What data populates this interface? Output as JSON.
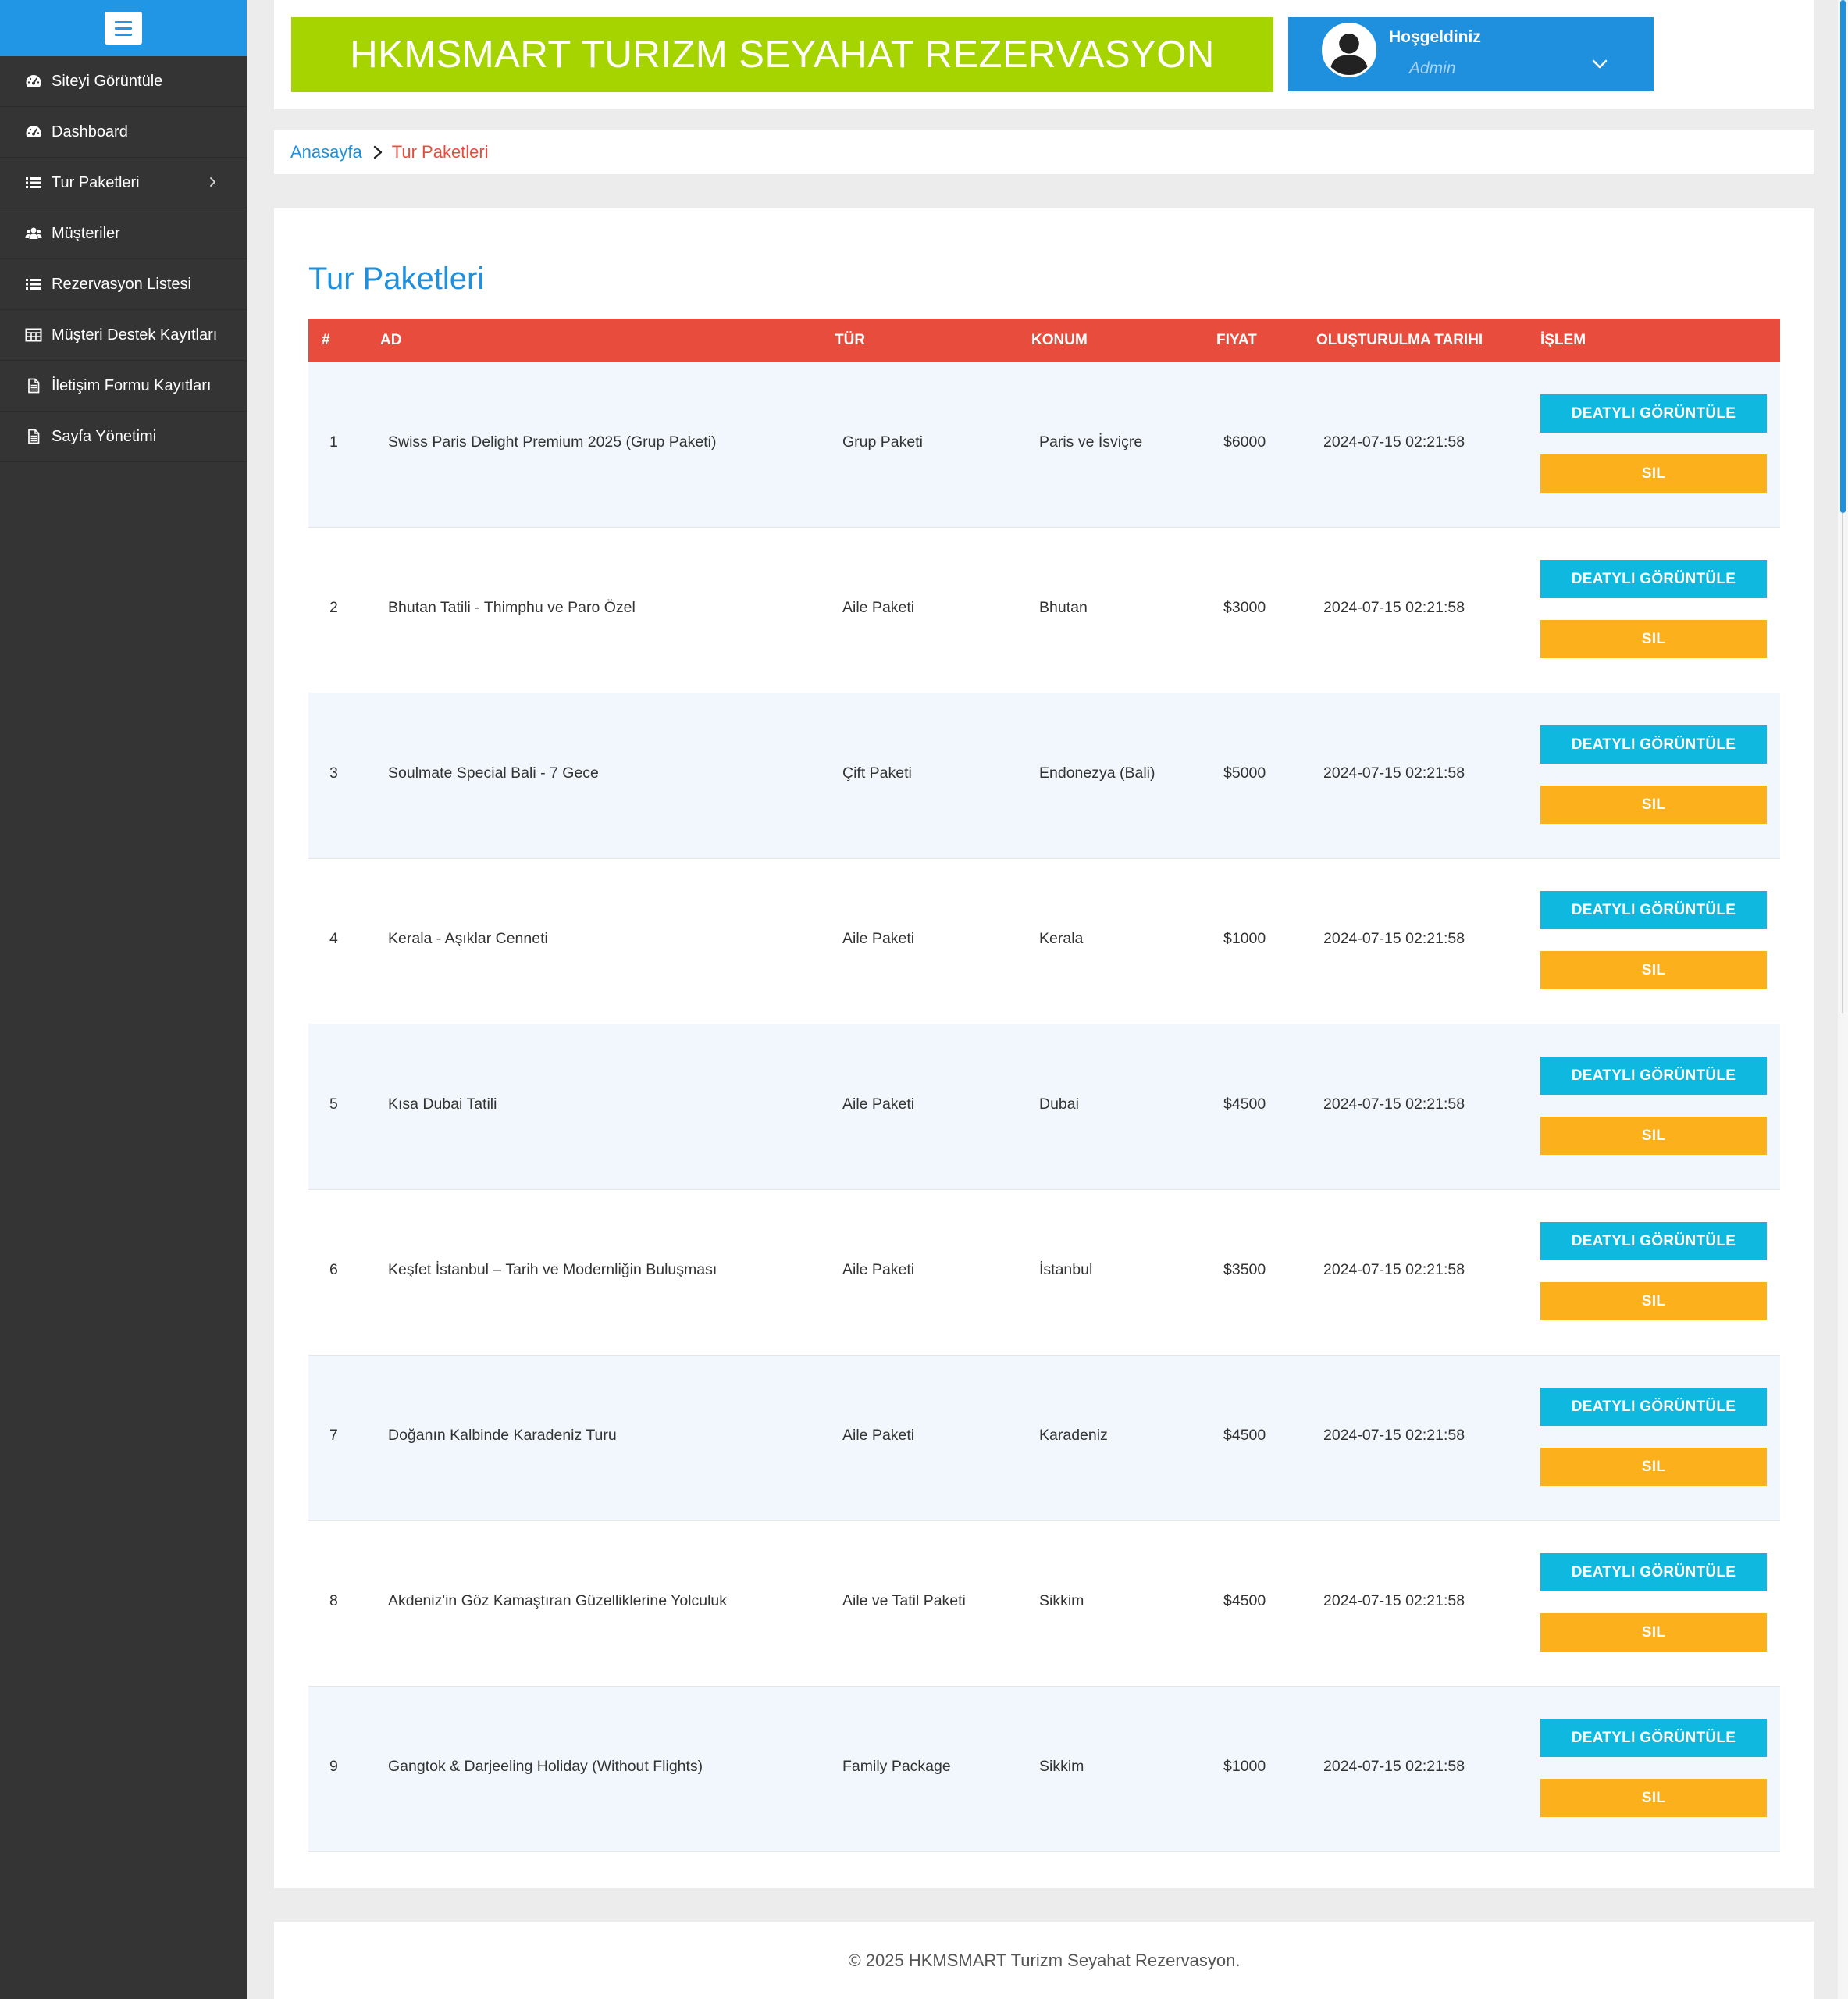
{
  "sidebar": {
    "items": [
      {
        "label": "Siteyi Görüntüle",
        "icon": "dashboard-gauge-icon"
      },
      {
        "label": "Dashboard",
        "icon": "dashboard-gauge-icon"
      },
      {
        "label": "Tur Paketleri",
        "icon": "list-icon",
        "has_submenu": true
      },
      {
        "label": "Müşteriler",
        "icon": "users-icon"
      },
      {
        "label": "Rezervasyon Listesi",
        "icon": "list-icon"
      },
      {
        "label": "Müşteri Destek Kayıtları",
        "icon": "table-icon"
      },
      {
        "label": "İletişim Formu Kayıtları",
        "icon": "file-text-icon"
      },
      {
        "label": "Sayfa Yönetimi",
        "icon": "file-text-icon"
      }
    ]
  },
  "header": {
    "brand": "HKMSMART TURIZM SEYAHAT REZERVASYON",
    "welcome": "Hoşgeldiniz",
    "role": "Admin"
  },
  "breadcrumb": {
    "home": "Anasayfa",
    "current": "Tur Paketleri"
  },
  "main": {
    "title": "Tur Paketleri",
    "columns": [
      "#",
      "AD",
      "TÜR",
      "KONUM",
      "FIYAT",
      "OLUŞTURULMA TARIHI",
      "İŞLEM"
    ],
    "detail_label": "DEATYLI GÖRÜNTÜLE",
    "delete_label": "SIL",
    "rows": [
      {
        "num": "1",
        "ad": "Swiss Paris Delight Premium 2025 (Grup Paketi)",
        "tur": "Grup Paketi",
        "konum": "Paris ve İsviçre",
        "fiyat": "$6000",
        "tarih": "2024-07-15 02:21:58"
      },
      {
        "num": "2",
        "ad": "Bhutan Tatili - Thimphu ve Paro Özel",
        "tur": "Aile Paketi",
        "konum": "Bhutan",
        "fiyat": "$3000",
        "tarih": "2024-07-15 02:21:58"
      },
      {
        "num": "3",
        "ad": "Soulmate Special Bali - 7 Gece",
        "tur": "Çift Paketi",
        "konum": "Endonezya (Bali)",
        "fiyat": "$5000",
        "tarih": "2024-07-15 02:21:58"
      },
      {
        "num": "4",
        "ad": "Kerala - Aşıklar Cenneti",
        "tur": "Aile Paketi",
        "konum": "Kerala",
        "fiyat": "$1000",
        "tarih": "2024-07-15 02:21:58"
      },
      {
        "num": "5",
        "ad": "Kısa Dubai Tatili",
        "tur": "Aile Paketi",
        "konum": "Dubai",
        "fiyat": "$4500",
        "tarih": "2024-07-15 02:21:58"
      },
      {
        "num": "6",
        "ad": "Keşfet İstanbul – Tarih ve Modernliğin Buluşması",
        "tur": "Aile Paketi",
        "konum": "İstanbul",
        "fiyat": "$3500",
        "tarih": "2024-07-15 02:21:58"
      },
      {
        "num": "7",
        "ad": "Doğanın Kalbinde Karadeniz Turu",
        "tur": "Aile Paketi",
        "konum": "Karadeniz",
        "fiyat": "$4500",
        "tarih": "2024-07-15 02:21:58"
      },
      {
        "num": "8",
        "ad": "Akdeniz'in Göz Kamaştıran Güzelliklerine Yolculuk",
        "tur": "Aile ve Tatil Paketi",
        "konum": "Sikkim",
        "fiyat": "$4500",
        "tarih": "2024-07-15 02:21:58"
      },
      {
        "num": "9",
        "ad": "Gangtok & Darjeeling Holiday (Without Flights)",
        "tur": "Family Package",
        "konum": "Sikkim",
        "fiyat": "$1000",
        "tarih": "2024-07-15 02:21:58"
      }
    ]
  },
  "footer": {
    "text": "© 2025 HKMSMART Turizm Seyahat Rezervasyon."
  },
  "colors": {
    "accent_blue": "#1e90dd",
    "brand_green": "#a5d400",
    "table_header_red": "#e74c3c",
    "detail_button": "#0fb8de",
    "delete_button": "#fbb01c",
    "sidebar_bg": "#343434"
  }
}
